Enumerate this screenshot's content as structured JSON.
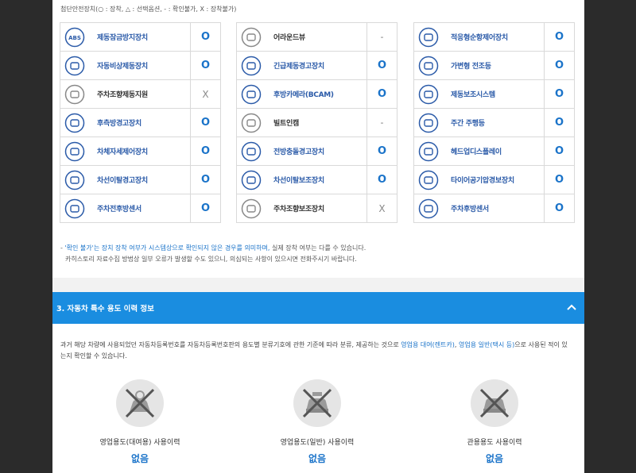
{
  "legend": "첨단안전장치(○ : 장착, △ : 선택옵션, - : 확인불가, X : 장착불가)",
  "safety_columns": [
    [
      {
        "name": "제동잠금방지장치",
        "status": "O",
        "icon": "abs-icon",
        "style": "blue"
      },
      {
        "name": "자동비상제동장치",
        "status": "O",
        "icon": "auto-emergency-brake-icon",
        "style": "blue"
      },
      {
        "name": "주차조향제동지원",
        "status": "X",
        "icon": "parking-steering-icon",
        "style": "dark"
      },
      {
        "name": "후측방경고장치",
        "status": "O",
        "icon": "rear-side-warning-icon",
        "style": "blue"
      },
      {
        "name": "차체자세제어장치",
        "status": "O",
        "icon": "stability-control-icon",
        "style": "blue"
      },
      {
        "name": "차선이탈경고장치",
        "status": "O",
        "icon": "lane-departure-warning-icon",
        "style": "blue"
      },
      {
        "name": "주차전후방센서",
        "status": "O",
        "icon": "parking-sensor-icon",
        "style": "blue"
      }
    ],
    [
      {
        "name": "어라운드뷰",
        "status": "-",
        "icon": "around-view-icon",
        "style": "dark"
      },
      {
        "name": "긴급제동경고장치",
        "status": "O",
        "icon": "emergency-brake-warning-icon",
        "style": "blue"
      },
      {
        "name": "후방카메라(BCAM)",
        "status": "O",
        "icon": "rear-camera-icon",
        "style": "blue"
      },
      {
        "name": "빌트인캠",
        "status": "-",
        "icon": "builtin-cam-icon",
        "style": "dark"
      },
      {
        "name": "전방충돌경고장치",
        "status": "O",
        "icon": "forward-collision-icon",
        "style": "blue"
      },
      {
        "name": "차선이탈보조장치",
        "status": "O",
        "icon": "lane-keeping-assist-icon",
        "style": "blue"
      },
      {
        "name": "주차조향보조장치",
        "status": "X",
        "icon": "parking-assist-icon",
        "style": "dark"
      }
    ],
    [
      {
        "name": "적응형순항제어장치",
        "status": "O",
        "icon": "adaptive-cruise-icon",
        "style": "blue"
      },
      {
        "name": "가변형 전조등",
        "status": "O",
        "icon": "adaptive-headlight-icon",
        "style": "blue"
      },
      {
        "name": "제동보조시스템",
        "status": "O",
        "icon": "brake-assist-icon",
        "style": "blue"
      },
      {
        "name": "주간 주행등",
        "status": "O",
        "icon": "daytime-running-light-icon",
        "style": "blue"
      },
      {
        "name": "헤드업디스플레이",
        "status": "O",
        "icon": "head-up-display-icon",
        "style": "blue"
      },
      {
        "name": "타이어공기압경보장치",
        "status": "O",
        "icon": "tire-pressure-icon",
        "style": "blue"
      },
      {
        "name": "주차후방센서",
        "status": "O",
        "icon": "rear-parking-sensor-icon",
        "style": "blue"
      }
    ]
  ],
  "note": {
    "line1_pre": "- ",
    "line1_hl": "'확인 불가'는 장치 장착 여부가 시스템상으로 확인되지 않은 경우를 의미하며,",
    "line1_post": " 실제 장착 여부는 다를 수 있습니다.",
    "line2": "카히스토리 자료수집 방법상 일부 오류가 발생할 수도 있으니, 의심되는 사항이 있으시면 전화주시기 바랍니다."
  },
  "section": {
    "title": "3. 자동차 특수 용도 이력 정보",
    "toggle": "^"
  },
  "description": {
    "pre": "과거 해당 차량에 사용되었던 자동차등록번호를 자동차등록번호판의 용도별 분류기호에 관한 기준에 따라 분류, 제공하는 것으로 ",
    "hl1": "영업용 대여(렌트카)",
    "mid": ", ",
    "hl2": "영업용 일반(택시 등)",
    "post": "으로 사용된 적이 있는지 확인할 수 있습니다."
  },
  "usage": [
    {
      "label": "영업용도(대여용) 사용이력",
      "value": "없음",
      "icon": "rental-car-icon"
    },
    {
      "label": "영업용도(일반) 사용이력",
      "value": "없음",
      "icon": "taxi-icon"
    },
    {
      "label": "관용용도 사용이력",
      "value": "없음",
      "icon": "government-car-icon"
    }
  ],
  "colors": {
    "accent": "#1a8de0",
    "blue_text": "#1a73c9",
    "label_blue": "#2a5aa8"
  }
}
